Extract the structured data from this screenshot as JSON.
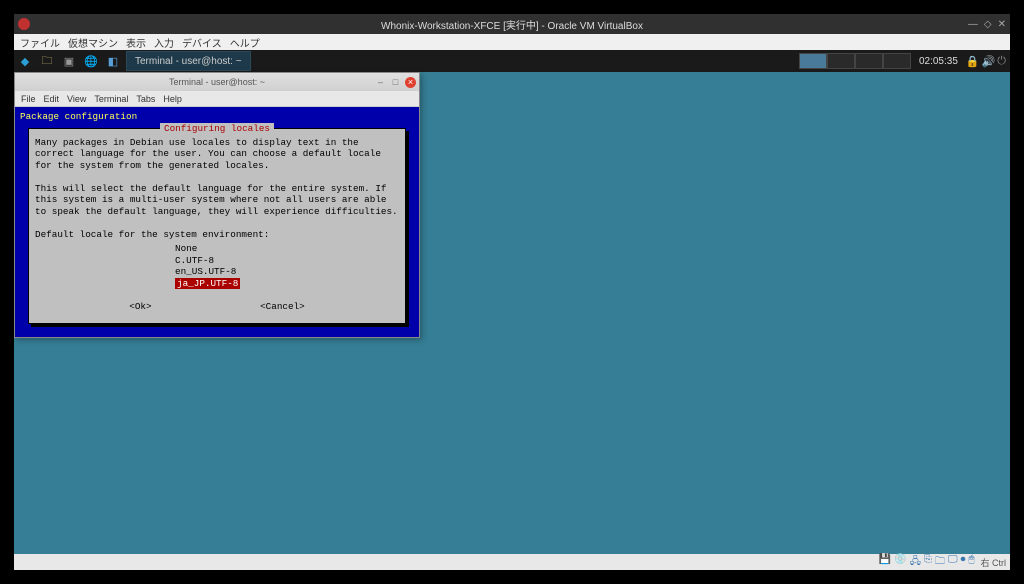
{
  "vbox": {
    "title": "Whonix-Workstation-XFCE [実行中] - Oracle VM VirtualBox",
    "menus": [
      "ファイル",
      "仮想マシン",
      "表示",
      "入力",
      "デバイス",
      "ヘルプ"
    ],
    "host_key": "右 Ctrl"
  },
  "guest": {
    "taskbar_item": "Terminal - user@host: ~",
    "clock": "02:05:35"
  },
  "terminal": {
    "title": "Terminal - user@host: ~",
    "menus": [
      "File",
      "Edit",
      "View",
      "Terminal",
      "Tabs",
      "Help"
    ],
    "pkg_header": "Package configuration",
    "dialog_title": " Configuring locales ",
    "para1": "Many packages in Debian use locales to display text in the correct language for the user. You can choose a default locale for the system from the generated locales.",
    "para2": "This will select the default language for the entire system. If this system is a multi-user system where not all users are able to speak the default language, they will experience difficulties.",
    "prompt": "Default locale for the system environment:",
    "options": {
      "o0": "None",
      "o1": "C.UTF-8",
      "o2": "en_US.UTF-8",
      "o3": "ja_JP.UTF-8"
    },
    "ok": "<Ok>",
    "cancel": "<Cancel>"
  }
}
